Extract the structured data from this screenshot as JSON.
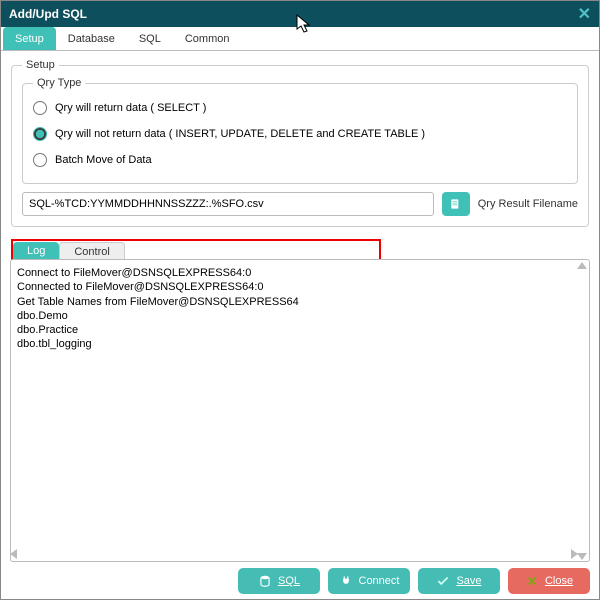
{
  "title": "Add/Upd SQL",
  "mainTabs": {
    "setup": "Setup",
    "database": "Database",
    "sql": "SQL",
    "common": "Common"
  },
  "fieldset": {
    "setup": "Setup",
    "qryType": "Qry Type",
    "radios": {
      "r1": "Qry will return data ( SELECT )",
      "r2": "Qry will not return data ( INSERT, UPDATE, DELETE and CREATE TABLE )",
      "r3": "Batch Move of Data"
    }
  },
  "file": {
    "value": "SQL-%TCD:YYMMDDHHNNSSZZZ:.%SFO.csv",
    "label": "Qry Result Filename"
  },
  "subTabs": {
    "log": "Log",
    "control": "Control"
  },
  "logtext": "Connect to FileMover@DSNSQLEXPRESS64:0\nConnected to FileMover@DSNSQLEXPRESS64:0\nGet Table Names from FileMover@DSNSQLEXPRESS64\ndbo.Demo\ndbo.Practice\ndbo.tbl_logging",
  "buttons": {
    "sql": "SQL",
    "connect": "Connect",
    "save": "Save",
    "close": "Close"
  }
}
